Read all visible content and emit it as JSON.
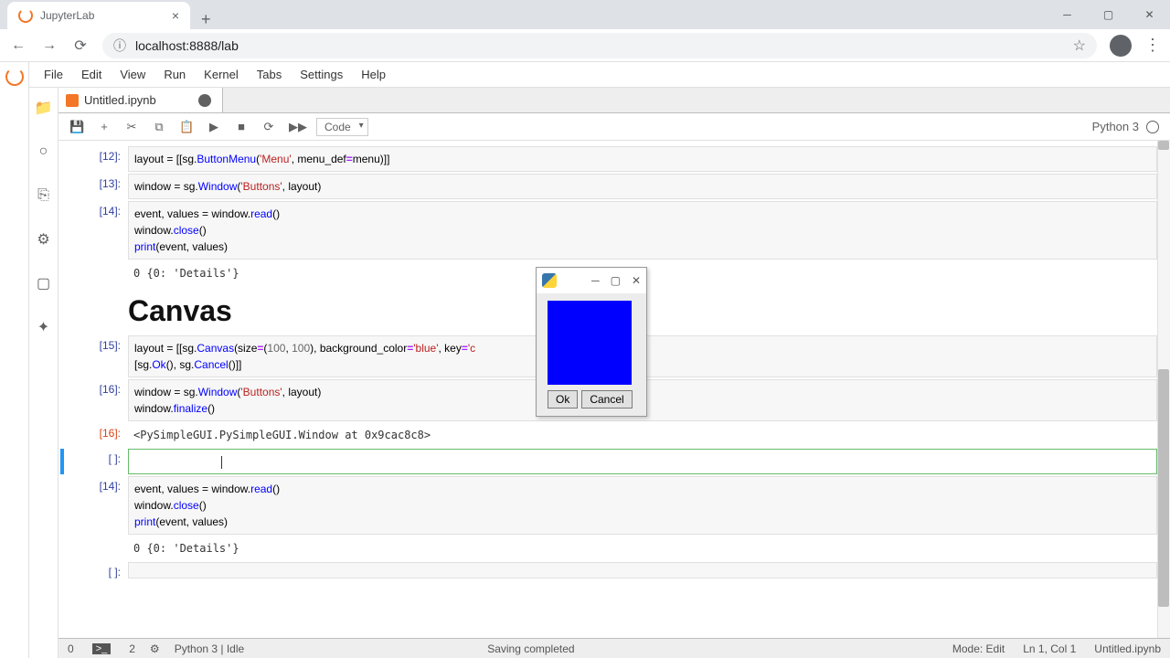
{
  "browser": {
    "tab_title": "JupyterLab",
    "url": "localhost:8888/lab"
  },
  "menubar": [
    "File",
    "Edit",
    "View",
    "Run",
    "Kernel",
    "Tabs",
    "Settings",
    "Help"
  ],
  "doc_tab": "Untitled.ipynb",
  "toolbar": {
    "cell_type": "Code",
    "kernel": "Python 3"
  },
  "cells": [
    {
      "type": "code",
      "n": "12",
      "code": "layout = [[sg.<fn>ButtonMenu</fn>(<str>'Menu'</str>, menu_def<op>=</op>menu)]]"
    },
    {
      "type": "code",
      "n": "13",
      "code": "window = sg.<fn>Window</fn>(<str>'Buttons'</str>, layout)"
    },
    {
      "type": "code",
      "n": "14",
      "code": "event, values = window.<fn>read</fn>()\nwindow.<fn>close</fn>()\n<fn>print</fn>(event, values)"
    },
    {
      "type": "output",
      "n": "",
      "text": "0 {0: 'Details'}"
    },
    {
      "type": "markdown",
      "heading": "Canvas"
    },
    {
      "type": "code",
      "n": "15",
      "code": "layout = [[sg.<fn>Canvas</fn>(size<op>=</op>(<num>100</num>, <num>100</num>), background_color<op>=</op><str>'blue'</str>, key<op>=</op><str>'c</str>\n          [sg.<fn>Ok</fn>(), sg.<fn>Cancel</fn>()]]"
    },
    {
      "type": "code",
      "n": "16",
      "code": "window = sg.<fn>Window</fn>(<str>'Buttons'</str>, layout)\nwindow.<fn>finalize</fn>()"
    },
    {
      "type": "outresult",
      "n": "16",
      "text": "<PySimpleGUI.PySimpleGUI.Window at 0x9cac8c8>"
    },
    {
      "type": "active",
      "n": " "
    },
    {
      "type": "code",
      "n": "14",
      "code": "event, values = window.<fn>read</fn>()\nwindow.<fn>close</fn>()\n<fn>print</fn>(event, values)"
    },
    {
      "type": "output",
      "n": "",
      "text": "0 {0: 'Details'}"
    },
    {
      "type": "code",
      "n": " ",
      "code": ""
    }
  ],
  "popup": {
    "ok": "Ok",
    "cancel": "Cancel",
    "canvas_color": "#0000FF"
  },
  "statusbar": {
    "left1": "0",
    "left2": "2",
    "kernel": "Python 3 | Idle",
    "center": "Saving completed",
    "mode": "Mode: Edit",
    "cursor": "Ln 1, Col 1",
    "file": "Untitled.ipynb"
  }
}
